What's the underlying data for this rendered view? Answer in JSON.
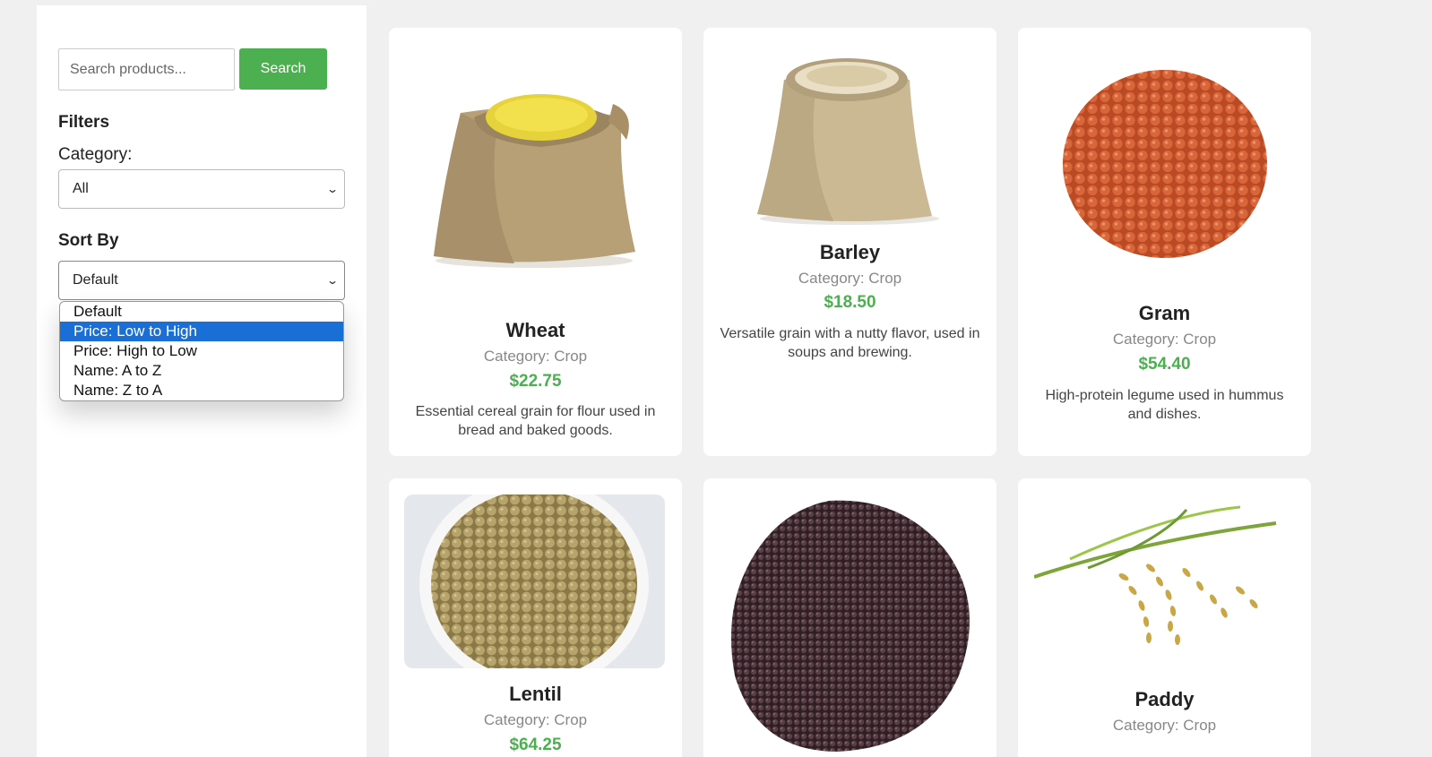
{
  "search": {
    "placeholder": "Search products...",
    "button_label": "Search"
  },
  "filters": {
    "title": "Filters",
    "category_label": "Category:",
    "category_value": "All",
    "sort_title": "Sort By",
    "sort_value": "Default",
    "sort_options": [
      "Default",
      "Price: Low to High",
      "Price: High to Low",
      "Name: A to Z",
      "Name: Z to A"
    ],
    "highlighted_option": "Price: Low to High"
  },
  "products": [
    {
      "name": "Wheat",
      "category": "Category: Crop",
      "price": "$22.75",
      "description": "Essential cereal grain for flour used in bread and baked goods."
    },
    {
      "name": "Barley",
      "category": "Category: Crop",
      "price": "$18.50",
      "description": "Versatile grain with a nutty flavor, used in soups and brewing."
    },
    {
      "name": "Gram",
      "category": "Category: Crop",
      "price": "$54.40",
      "description": "High-protein legume used in hummus and dishes."
    },
    {
      "name": "Lentil",
      "category": "Category: Crop",
      "price": "$64.25",
      "description": ""
    },
    {
      "name": "",
      "category": "",
      "price": "",
      "description": ""
    },
    {
      "name": "Paddy",
      "category": "Category: Crop",
      "price": "",
      "description": ""
    }
  ],
  "colors": {
    "accent": "#4caf50",
    "selection": "#1a6fd6",
    "background": "#f0f0f0"
  }
}
